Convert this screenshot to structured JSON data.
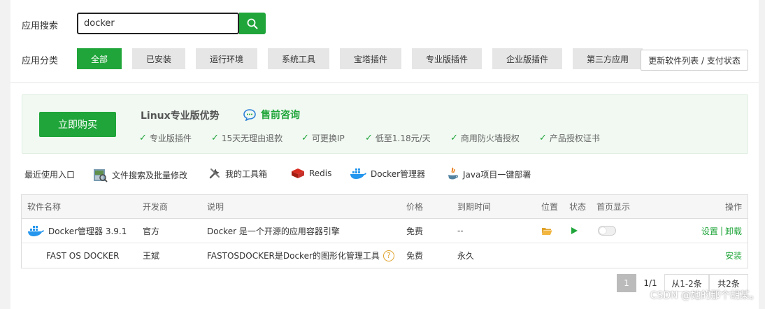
{
  "search": {
    "label": "应用搜索",
    "value": "docker"
  },
  "categories": {
    "label": "应用分类",
    "tabs": [
      "全部",
      "已安装",
      "运行环境",
      "系统工具",
      "宝塔插件",
      "专业版插件",
      "企业版插件",
      "第三方应用"
    ],
    "active_index": 0,
    "refresh_label": "更新软件列表 / 支付状态"
  },
  "promo": {
    "buy_label": "立即购买",
    "title": "Linux专业版优势",
    "consult_label": "售前咨询",
    "features": [
      "专业版插件",
      "15天无理由退款",
      "可更换IP",
      "低至1.18元/天",
      "商用防火墙授权",
      "产品授权证书"
    ]
  },
  "recent": {
    "label": "最近使用入口",
    "items": [
      {
        "label": "文件搜索及批量修改",
        "icon": "file-search-icon"
      },
      {
        "label": "我的工具箱",
        "icon": "toolbox-icon"
      },
      {
        "label": "Redis",
        "icon": "redis-icon"
      },
      {
        "label": "Docker管理器",
        "icon": "docker-icon"
      },
      {
        "label": "Java项目一键部署",
        "icon": "java-icon"
      }
    ]
  },
  "table": {
    "headers": {
      "name": "软件名称",
      "developer": "开发商",
      "description": "说明",
      "price": "价格",
      "expiry": "到期时间",
      "location": "位置",
      "status": "状态",
      "homepage": "首页显示",
      "actions": "操作"
    },
    "rows": [
      {
        "name": "Docker管理器 3.9.1",
        "developer": "官方",
        "description": "Docker 是一个开源的应用容器引擎",
        "price": "免费",
        "expiry": "--",
        "action1": "设置",
        "separator": "|",
        "action2": "卸载"
      },
      {
        "name": "FAST OS DOCKER",
        "developer": "王斌",
        "description": "FASTOSDOCKER是Docker的图形化管理工具",
        "help": "?",
        "price": "免费",
        "expiry": "永久",
        "action1": "安装"
      }
    ]
  },
  "pagination": {
    "current": "1",
    "pages": "1/1",
    "range": "从1-2条",
    "total": "共2条"
  },
  "watermark": "CSDN @她的那个胡某。",
  "colors": {
    "accent": "#20a53a",
    "docker_blue": "#2496ed",
    "redis_red": "#c6302b",
    "folder_yellow": "#f2b53f"
  }
}
